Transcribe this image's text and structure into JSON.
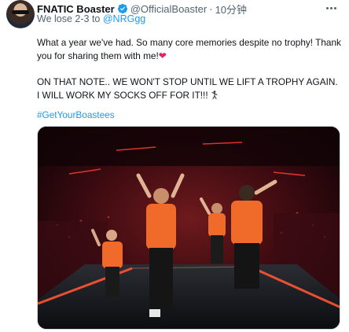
{
  "author": {
    "display_name": "FNATIC Boaster",
    "handle": "@OfficialBoaster",
    "separator": "·",
    "timestamp": "10分钟",
    "verified": true
  },
  "reply": {
    "text": "We lose 2-3 to",
    "mention": "@NRGgg"
  },
  "body": {
    "p1": "What a year we've had. So many core memories despite no trophy! Thank you for sharing them with me!",
    "p1_emoji": "❤",
    "p2": "ON THAT NOTE.. WE WON'T STOP UNTIL WE LIFT A TROPHY AGAIN. I WILL WORK MY SOCKS OFF FOR IT!!!",
    "p2_emoji": "figure-icon",
    "hashtag": "#GetYourBoastees"
  },
  "media": {
    "icon": "stage-photo"
  },
  "colors": {
    "link": "#1d9bf0",
    "verified": "#1d9bf0",
    "muted": "#536471",
    "heart": "#e0245e",
    "jersey": "#f06a2a"
  }
}
